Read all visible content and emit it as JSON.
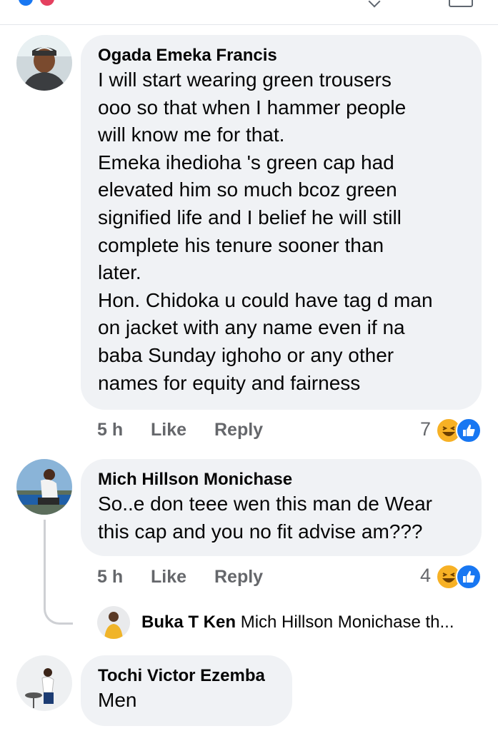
{
  "comments": [
    {
      "author": "Ogada Emeka Francis",
      "text": "I will start wearing green trousers\nooo so that when I hammer people\nwill know me for that.\nEmeka ihedioha 's green cap had\nelevated him so much bcoz green\nsignified life and I belief he will still\ncomplete his tenure sooner than\nlater.\nHon. Chidoka u could have tag d man\non jacket with any name even if na\nbaba Sunday ighoho or any other\nnames for equity and fairness",
      "time": "5 h",
      "like_label": "Like",
      "reply_label": "Reply",
      "reaction_count": "7",
      "reactions": [
        "haha-icon",
        "like-icon"
      ]
    },
    {
      "author": "Mich Hillson Monichase",
      "text": "So..e don teee wen this man de Wear\nthis cap and you no fit advise am???",
      "time": "5 h",
      "like_label": "Like",
      "reply_label": "Reply",
      "reaction_count": "4",
      "reactions": [
        "haha-icon",
        "like-icon"
      ],
      "reply_preview": {
        "author": "Buka T Ken",
        "text": "Mich Hillson Monichase th..."
      }
    },
    {
      "author": "Tochi Victor Ezemba",
      "text": "Men"
    }
  ],
  "colors": {
    "bubble": "#f0f2f5",
    "meta_text": "#65676b",
    "like_blue": "#1877f2",
    "haha_yellow": "#f7b125"
  }
}
